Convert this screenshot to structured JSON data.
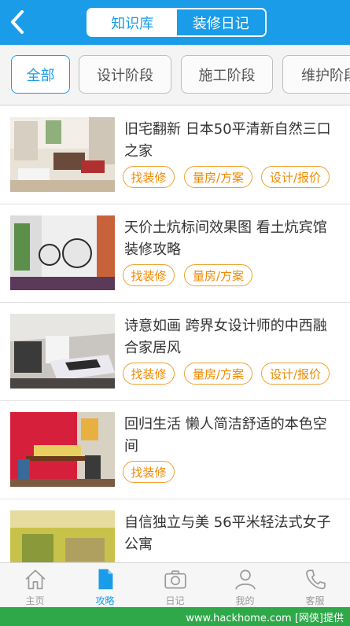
{
  "header": {
    "segments": [
      {
        "label": "知识库",
        "active": true
      },
      {
        "label": "装修日记",
        "active": false
      }
    ],
    "colors": {
      "primary": "#1a9ce8"
    }
  },
  "filters": [
    {
      "label": "全部",
      "active": true
    },
    {
      "label": "设计阶段",
      "active": false
    },
    {
      "label": "施工阶段",
      "active": false
    },
    {
      "label": "维护阶段",
      "active": false
    }
  ],
  "articles": [
    {
      "title": "旧宅翻新 日本50平清新自然三口之家",
      "tags": [
        "找装修",
        "量房/方案",
        "设计/报价"
      ]
    },
    {
      "title": "天价土炕标间效果图 看土炕宾馆装修攻略",
      "tags": [
        "找装修",
        "量房/方案"
      ]
    },
    {
      "title": "诗意如画 跨界女设计师的中西融合家居风",
      "tags": [
        "找装修",
        "量房/方案",
        "设计/报价"
      ]
    },
    {
      "title": "回归生活 懒人简洁舒适的本色空间",
      "tags": [
        "找装修"
      ]
    },
    {
      "title": "自信独立与美 56平米轻法式女子公寓",
      "tags": []
    }
  ],
  "tabbar": [
    {
      "label": "主页",
      "icon": "house-icon",
      "active": false
    },
    {
      "label": "攻略",
      "icon": "document-icon",
      "active": true
    },
    {
      "label": "日记",
      "icon": "camera-icon",
      "active": false
    },
    {
      "label": "我的",
      "icon": "user-icon",
      "active": false
    },
    {
      "label": "客服",
      "icon": "phone-icon",
      "active": false
    }
  ],
  "watermark": "www.hackhome.com [网侠]提供"
}
